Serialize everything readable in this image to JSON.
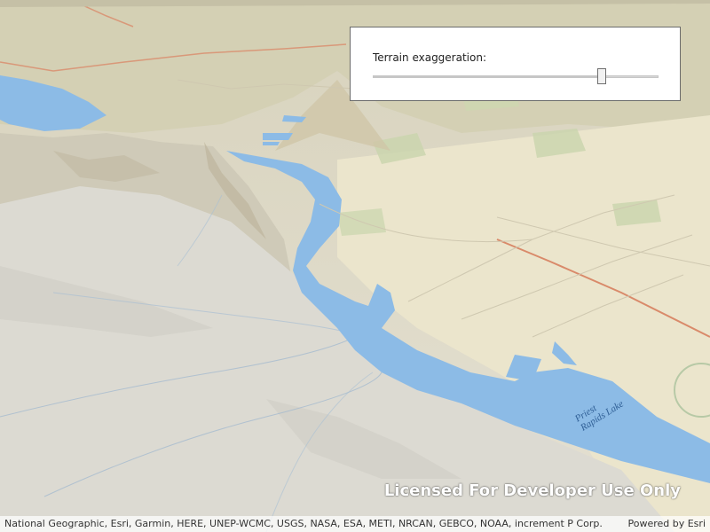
{
  "map": {
    "labels": {
      "lake": "Priest Rapids Lake"
    }
  },
  "terrain_panel": {
    "label": "Terrain exaggeration:",
    "slider": {
      "min": 0,
      "max": 1,
      "value": 0.81
    }
  },
  "watermark": "Licensed For Developer Use Only",
  "attribution": {
    "text": "National Geographic, Esri, Garmin, HERE, UNEP-WCMC, USGS, NASA, ESA, METI, NRCAN, GEBCO, NOAA, increment P Corp.",
    "powered_by": "Powered by Esri"
  },
  "colors": {
    "water": "#8cbbe6",
    "terrain": "#e3dfcf",
    "highway": "#d98a6a"
  }
}
